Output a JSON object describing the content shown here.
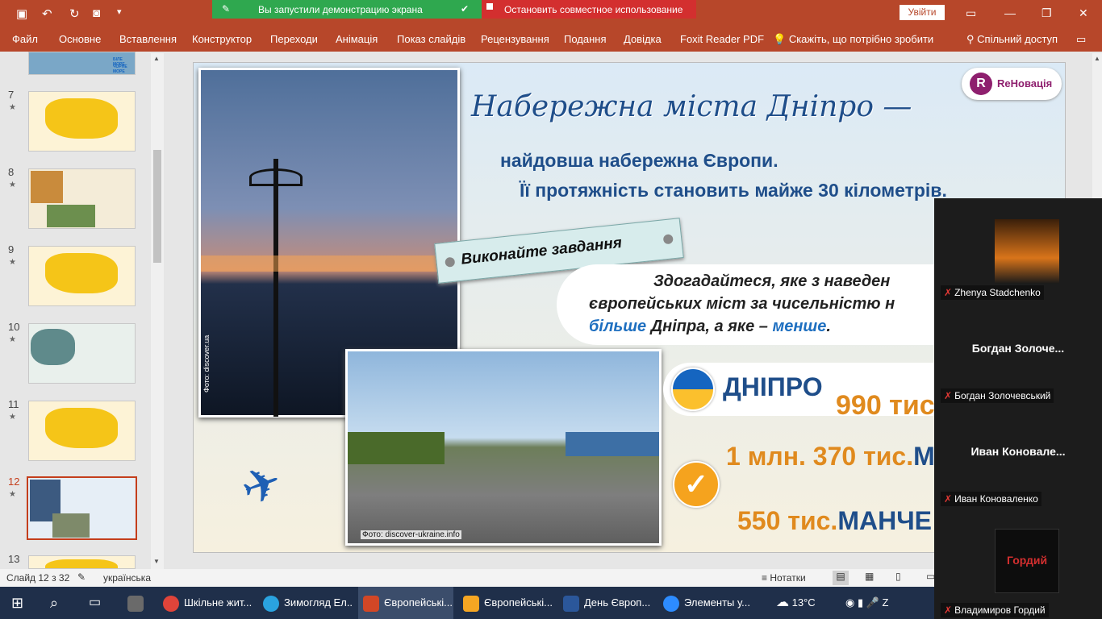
{
  "app": {
    "qa_icons": [
      "save-icon",
      "undo-icon",
      "redo-icon",
      "present-icon",
      "customize-icon"
    ],
    "sharing_green": "Вы запустили демонстрацию экрана",
    "sharing_red": "Остановить совместное использование",
    "signin": "Увійти"
  },
  "tabs": [
    "Файл",
    "Основне",
    "Вставлення",
    "Конструктор",
    "Переходи",
    "Анімація",
    "Показ слайдів",
    "Рецензування",
    "Подання",
    "Довідка",
    "Foxit Reader PDF"
  ],
  "tellme": "Скажіть, що потрібно зробити",
  "share": "Спільний доступ",
  "thumbs": [
    {
      "num": "7",
      "star": "★"
    },
    {
      "num": "8",
      "star": "★"
    },
    {
      "num": "9",
      "star": "★"
    },
    {
      "num": "10",
      "star": "★"
    },
    {
      "num": "11",
      "star": "★"
    },
    {
      "num": "12",
      "star": "★"
    },
    {
      "num": "13",
      "star": ""
    }
  ],
  "thumb_top_text": [
    "БІЛЕ МОРЕ",
    "ЧОРНЕ МОРЕ"
  ],
  "slide": {
    "logo": "ReНовація",
    "title_line1": "Набережна міста Дніпро —",
    "title_line2": "найдовша набережна Європи.",
    "title_line3": "Її протяжність становить майже 30 кілометрів.",
    "task": "Виконайте завдання",
    "q_line1": "Здогадайтеся, яке з наведен",
    "q_line2": "європейських міст за чисельністю н",
    "q_more": "більше",
    "q_mid": " Дніпра, а яке –",
    "q_less": "менше",
    "q_dot": ".",
    "photo1_credit": "Фото: discover.ua",
    "photo2_credit": "Фото: discover-ukraine.info",
    "city1": "ДНІПРО",
    "val1": "990 тис",
    "val2": "1 млн. 370 тис.",
    "val2b": "М",
    "val3": "550 тис.",
    "val3b": "МАНЧЕ"
  },
  "status": {
    "slide": "Слайд 12 з 32",
    "lang": "українська",
    "notes": "Нотатки"
  },
  "taskbar": [
    {
      "label": "Шкільне жит...",
      "color": "#e0443a"
    },
    {
      "label": "Зимогляд Ел...",
      "color": "#2aa3e0"
    },
    {
      "label": "Європейські...",
      "color": "#d24726"
    },
    {
      "label": "Європейські...",
      "color": "#f5a623"
    },
    {
      "label": "День Європ...",
      "color": "#2b579a"
    },
    {
      "label": "Элементы у...",
      "color": "#2d8cff"
    }
  ],
  "weather": "13°C",
  "participants": [
    {
      "name": "Zhenya Stadchenko",
      "big": ""
    },
    {
      "name": "Богдан Золочевський",
      "big": "Богдан Золоче..."
    },
    {
      "name": "Иван Коноваленко",
      "big": "Иван Коновале..."
    },
    {
      "name": "Владимиров Гордий",
      "big": "Гордий"
    }
  ]
}
